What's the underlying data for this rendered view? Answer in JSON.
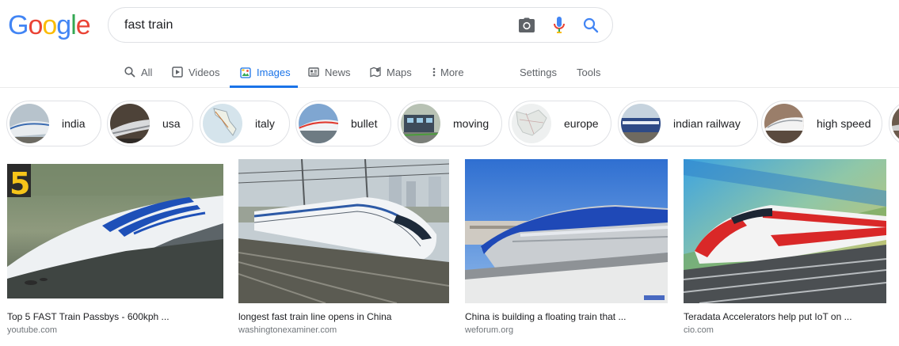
{
  "logo": {
    "letters": [
      {
        "ch": "G",
        "color": "#4285F4"
      },
      {
        "ch": "o",
        "color": "#EA4335"
      },
      {
        "ch": "o",
        "color": "#FBBC05"
      },
      {
        "ch": "g",
        "color": "#4285F4"
      },
      {
        "ch": "l",
        "color": "#34A853"
      },
      {
        "ch": "e",
        "color": "#EA4335"
      }
    ]
  },
  "search": {
    "query": "fast train",
    "camera_icon": "camera-icon",
    "mic_icon": "mic-icon",
    "search_icon": "search-icon"
  },
  "tabs": {
    "all": "All",
    "videos": "Videos",
    "images": "Images",
    "news": "News",
    "maps": "Maps",
    "more": "More",
    "settings": "Settings",
    "tools": "Tools",
    "active": "images",
    "accent": "#1a73e8"
  },
  "chips": [
    {
      "label": "india"
    },
    {
      "label": "usa"
    },
    {
      "label": "italy"
    },
    {
      "label": "bullet"
    },
    {
      "label": "moving"
    },
    {
      "label": "europe"
    },
    {
      "label": "indian railway"
    },
    {
      "label": "high speed"
    }
  ],
  "results": [
    {
      "title": "Top 5 FAST Train Passbys - 600kph ...",
      "source": "youtube.com",
      "badge": "5"
    },
    {
      "title": "longest fast train line opens in China",
      "source": "washingtonexaminer.com"
    },
    {
      "title": "China is building a floating train that ...",
      "source": "weforum.org"
    },
    {
      "title": "Teradata Accelerators help put IoT on ...",
      "source": "cio.com"
    }
  ]
}
